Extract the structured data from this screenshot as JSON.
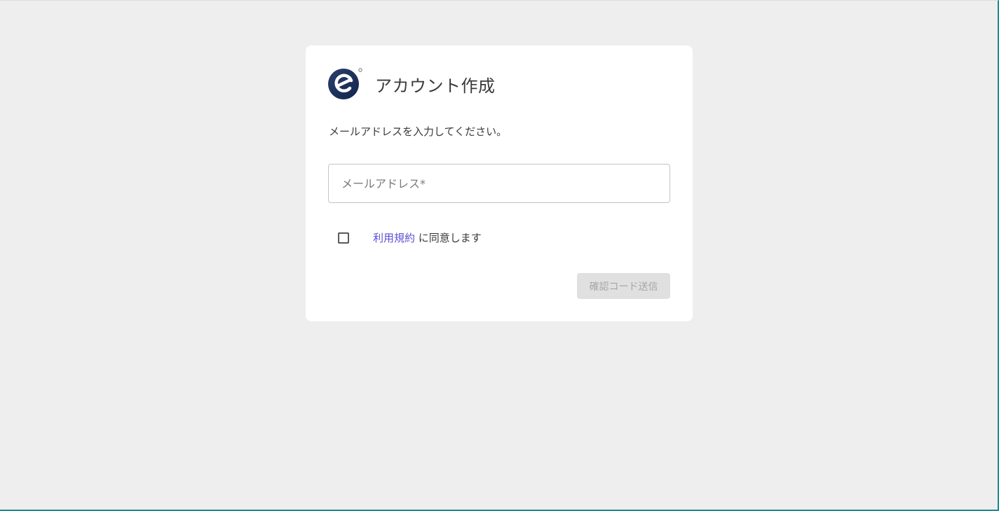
{
  "card": {
    "title": "アカウント作成",
    "instruction": "メールアドレスを入力してください。",
    "logo_icon": "brand-logo-icon"
  },
  "email": {
    "placeholder": "メールアドレス*",
    "value": ""
  },
  "terms": {
    "link_text": "利用規約",
    "suffix_text": " に同意します",
    "checked": false
  },
  "actions": {
    "send_code_label": "確認コード送信",
    "send_code_disabled": true
  },
  "colors": {
    "background": "#eeeeee",
    "card": "#ffffff",
    "link": "#5b4fd6",
    "logo_dark": "#1d3557",
    "button_disabled_bg": "#e0e0e0",
    "button_disabled_text": "#a6a6a6"
  }
}
